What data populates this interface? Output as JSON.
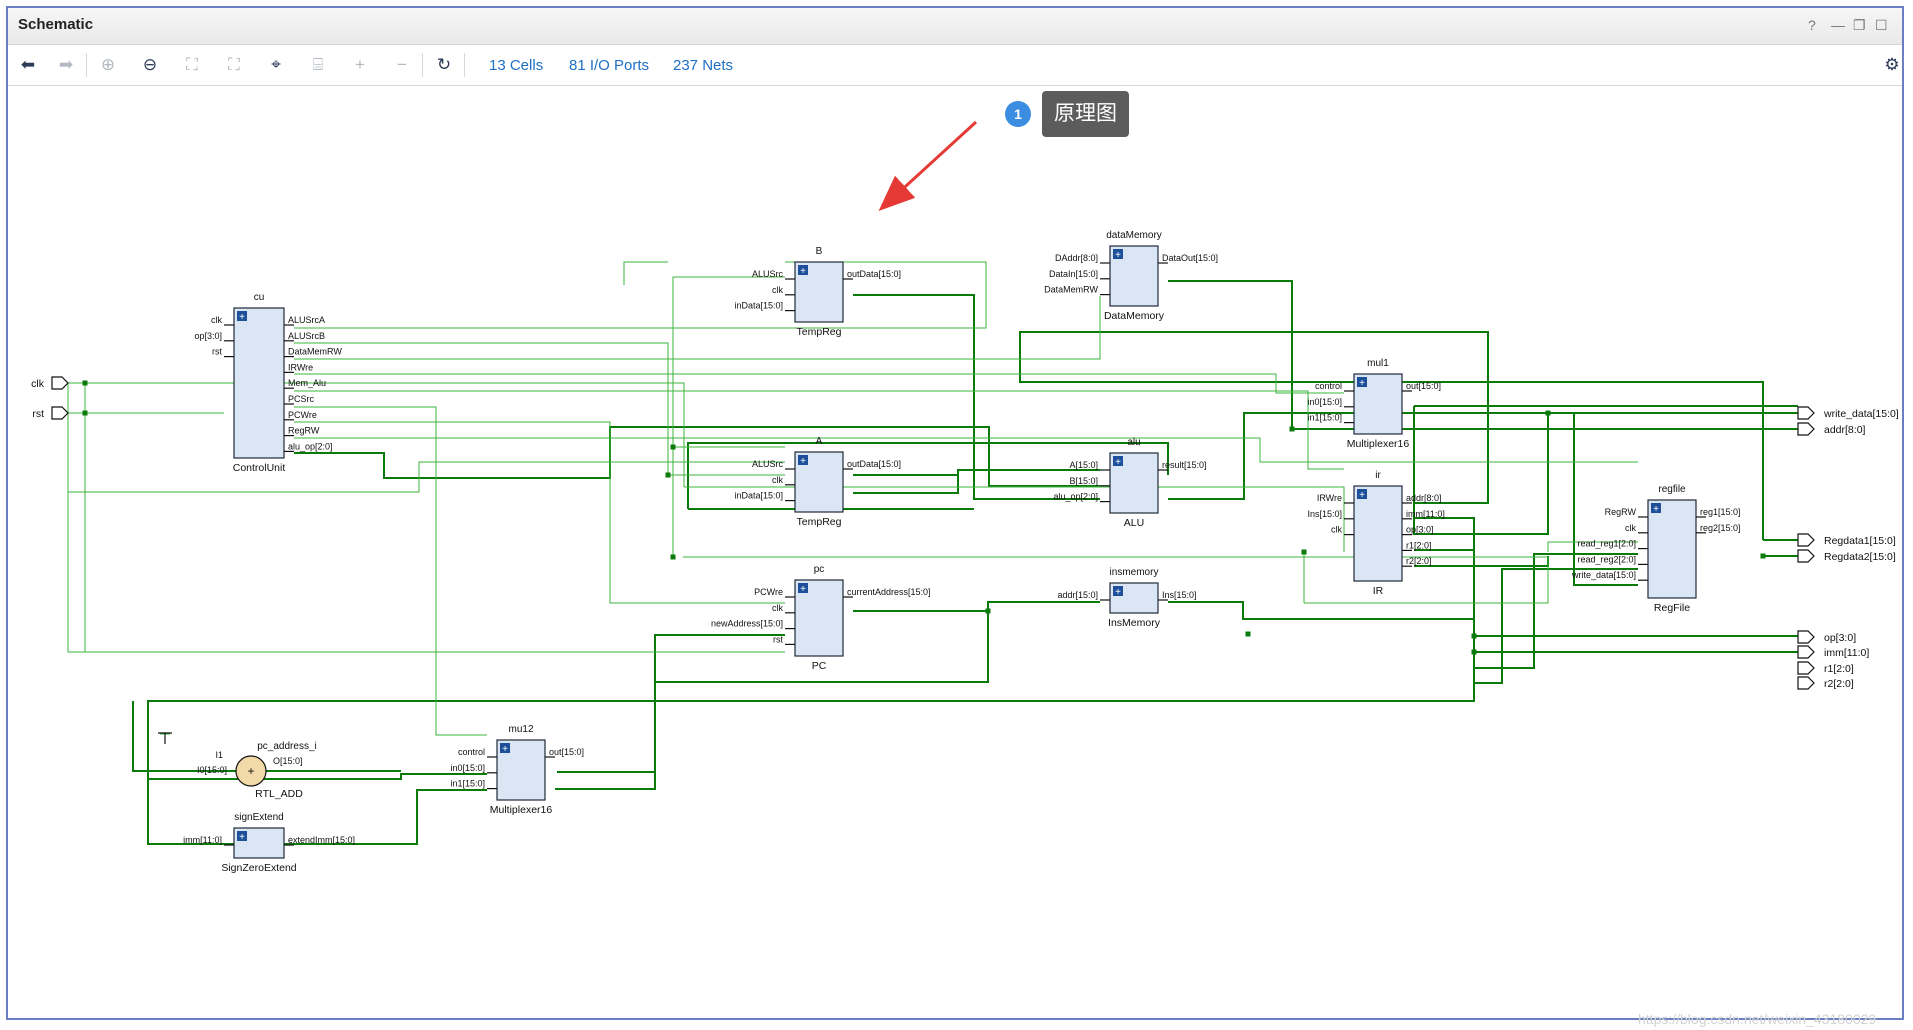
{
  "window": {
    "title": "Schematic",
    "controls": [
      "?",
      "—",
      "❐",
      "☐"
    ]
  },
  "toolbar": {
    "cells": "13 Cells",
    "io_ports": "81 I/O Ports",
    "nets": "237 Nets"
  },
  "callout": {
    "number": "1",
    "text": "原理图"
  },
  "watermark": "https://blog.csdn.net/weixin_43180029",
  "schematic": {
    "inputs": [
      "clk",
      "rst"
    ],
    "outputs": [
      "write_data[15:0]",
      "addr[8:0]",
      "Regdata1[15:0]",
      "Regdata2[15:0]",
      "op[3:0]",
      "imm[11:0]",
      "r1[2:0]",
      "r2[2:0]"
    ],
    "cells": {
      "cu": {
        "inst": "cu",
        "type": "ControlUnit",
        "in": [
          "clk",
          "op[3:0]",
          "rst"
        ],
        "out": [
          "ALUSrcA",
          "ALUSrcB",
          "DataMemRW",
          "IRWre",
          "Mem_Alu",
          "PCSrc",
          "PCWre",
          "RegRW",
          "alu_op[2:0]"
        ]
      },
      "B": {
        "inst": "B",
        "type": "TempReg",
        "in": [
          "ALUSrc",
          "clk",
          "inData[15:0]"
        ],
        "out": [
          "outData[15:0]"
        ]
      },
      "A": {
        "inst": "A",
        "type": "TempReg",
        "in": [
          "ALUSrc",
          "clk",
          "inData[15:0]"
        ],
        "out": [
          "outData[15:0]"
        ]
      },
      "pc": {
        "inst": "pc",
        "type": "PC",
        "in": [
          "PCWre",
          "clk",
          "newAddress[15:0]",
          "rst"
        ],
        "out": [
          "currentAddress[15:0]"
        ]
      },
      "dataMemory": {
        "inst": "dataMemory",
        "type": "DataMemory",
        "in": [
          "DAddr[8:0]",
          "DataIn[15:0]",
          "DataMemRW"
        ],
        "out": [
          "DataOut[15:0]"
        ]
      },
      "alu": {
        "inst": "alu",
        "type": "ALU",
        "in": [
          "A[15:0]",
          "B[15:0]",
          "alu_op[2:0]"
        ],
        "out": [
          "result[15:0]"
        ]
      },
      "insmemory": {
        "inst": "insmemory",
        "type": "InsMemory",
        "in": [
          "addr[15:0]"
        ],
        "out": [
          "Ins[15:0]"
        ]
      },
      "mul1": {
        "inst": "mul1",
        "type": "Multiplexer16",
        "in": [
          "control",
          "in0[15:0]",
          "in1[15:0]"
        ],
        "out": [
          "out[15:0]"
        ]
      },
      "ir": {
        "inst": "ir",
        "type": "IR",
        "in": [
          "IRWre",
          "Ins[15:0]",
          "clk"
        ],
        "out": [
          "addr[8:0]",
          "imm[11:0]",
          "op[3:0]",
          "r1[2:0]",
          "r2[2:0]"
        ]
      },
      "regfile": {
        "inst": "regfile",
        "type": "RegFile",
        "in": [
          "RegRW",
          "clk",
          "read_reg1[2:0]",
          "read_reg2[2:0]",
          "write_data[15:0]"
        ],
        "out": [
          "reg1[15:0]",
          "reg2[15:0]"
        ]
      },
      "mu12": {
        "inst": "mu12",
        "type": "Multiplexer16",
        "in": [
          "control",
          "in0[15:0]",
          "in1[15:0]"
        ],
        "out": [
          "out[15:0]"
        ]
      },
      "signExtend": {
        "inst": "signExtend",
        "type": "SignZeroExtend",
        "in": [
          "imm[11:0]"
        ],
        "out": [
          "extendImm[15:0]"
        ]
      },
      "pc_address_i": {
        "inst": "pc_address_i",
        "type": "RTL_ADD",
        "in": [
          "I1",
          "I0[15:0]"
        ],
        "out": [
          "O[15:0]"
        ],
        "symbol": "+"
      }
    }
  },
  "colors": {
    "wire_bus": "#0a7a0a",
    "wire_net": "#3cb43c",
    "cell_fill": "#dbe6f4",
    "cell_border": "#1e2a3a",
    "link": "#1f6fc5"
  }
}
